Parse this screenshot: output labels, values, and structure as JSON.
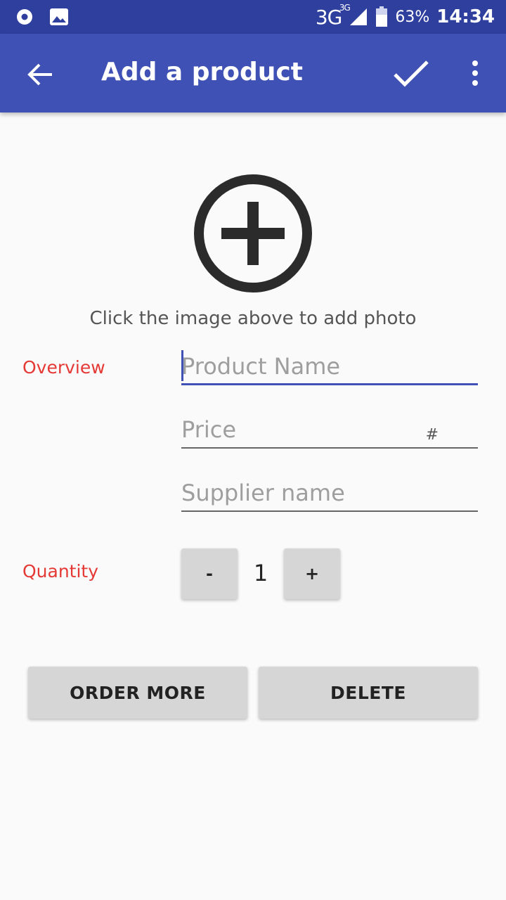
{
  "status_bar": {
    "network": "3G",
    "network_small": "3G",
    "battery": "63%",
    "time": "14:34",
    "icons": [
      "record-icon",
      "image-icon",
      "signal-icon",
      "battery-icon"
    ]
  },
  "app_bar": {
    "title": "Add a product",
    "icons": [
      "back-arrow-icon",
      "check-icon",
      "more-vert-icon"
    ]
  },
  "photo": {
    "icon": "add-circle-icon",
    "hint": "Click the image above to add photo"
  },
  "overview": {
    "label": "Overview",
    "product_name_placeholder": "Product Name",
    "product_name_value": "",
    "price_placeholder": "Price",
    "price_value": "",
    "price_suffix": "#",
    "supplier_placeholder": "Supplier name",
    "supplier_value": ""
  },
  "quantity": {
    "label": "Quantity",
    "minus_label": "-",
    "plus_label": "+",
    "value": "1"
  },
  "actions": {
    "order_more": "ORDER MORE",
    "delete": "DELETE"
  },
  "colors": {
    "status_bar": "#2f3f9e",
    "app_bar": "#3f51b5",
    "label_red": "#e53935",
    "button_gray": "#d6d6d6"
  }
}
